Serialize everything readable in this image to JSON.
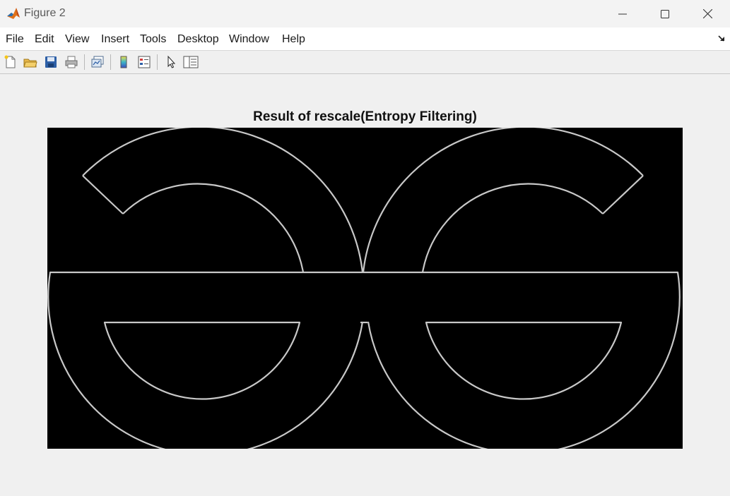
{
  "window": {
    "title": "Figure 2",
    "app_icon": "matlab-icon"
  },
  "menu": {
    "items": [
      "File",
      "Edit",
      "View",
      "Insert",
      "Tools",
      "Desktop",
      "Window",
      "Help"
    ]
  },
  "toolbar": {
    "icons": [
      "new-figure-icon",
      "open-file-icon",
      "save-icon",
      "print-icon",
      "link-plot-icon",
      "colorbar-icon",
      "legend-icon",
      "pointer-icon",
      "property-editor-icon"
    ]
  },
  "figure": {
    "title": "Result of rescale(Entropy Filtering)",
    "image_background": "#000000",
    "edge_color": "#c8c8c8"
  }
}
